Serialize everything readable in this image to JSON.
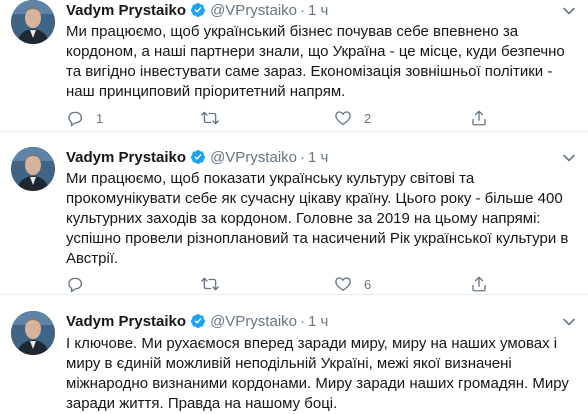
{
  "account": {
    "name": "Vadym Prystaiko",
    "handle": "@VPrystaiko",
    "separator": "·"
  },
  "colors": {
    "text": "#14171a",
    "secondary": "#657786",
    "verified": "#1da1f2",
    "divider": "#e6ecf0"
  },
  "tweets": [
    {
      "time": "1 ч",
      "text": "Ми працюємо, щоб український бізнес почував себе впевнено за кордоном, а наші партнери знали, що Україна - це місце, куди безпечно та вигідно інвестувати саме зараз. Економізація зовнішньої політики - наш принциповий пріоритетний напрям.",
      "reply_count": "1",
      "retweet_count": "",
      "like_count": "2"
    },
    {
      "time": "1 ч",
      "text": "Ми працюємо, щоб показати українську культуру світові та прокомунікувати себе як сучасну цікаву країну. Цього року - більше 400 культурних заходів за кордоном. Головне за 2019 на цьому напрямі: успішно провели різноплановий та насичений Рік української культури в Австрії.",
      "reply_count": "",
      "retweet_count": "",
      "like_count": "6"
    },
    {
      "time": "1 ч",
      "text": "І ключове. Ми рухаємося вперед заради миру, миру на наших умовах і миру в єдиній можливій неподільній Україні, межі якої визначені міжнародно визнаними кордонами. Миру заради наших громадян. Миру заради життя. Правда на нашому боці."
    }
  ],
  "icons": {
    "verified": "verified-badge-icon",
    "caret": "chevron-down-icon",
    "reply": "reply-icon",
    "retweet": "retweet-icon",
    "like": "heart-icon",
    "share": "share-icon"
  }
}
